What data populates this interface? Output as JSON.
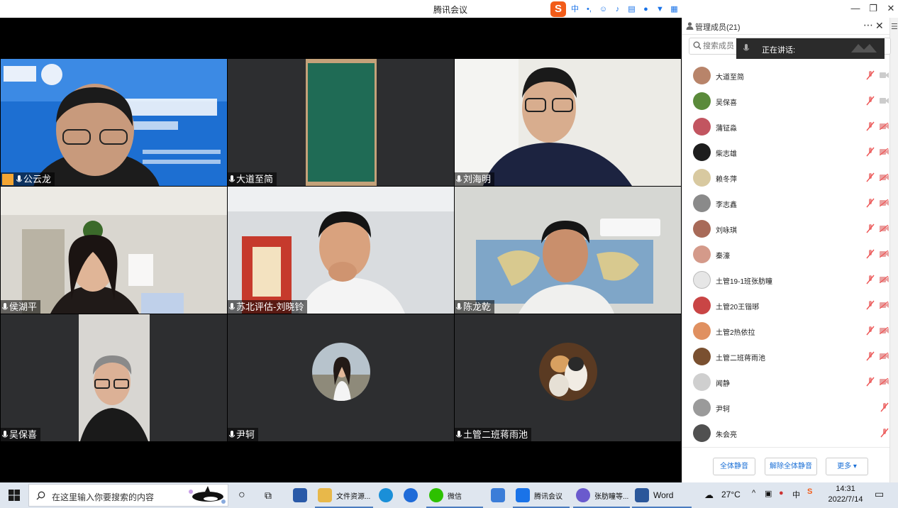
{
  "window": {
    "title": "腾讯会议"
  },
  "video_tiles": [
    {
      "name": "公云龙",
      "host": true
    },
    {
      "name": "大道至简"
    },
    {
      "name": "刘海明"
    },
    {
      "name": "侯湖平"
    },
    {
      "name": "苏北评估-刘晓铃"
    },
    {
      "name": "陈龙乾"
    },
    {
      "name": "吴保喜"
    },
    {
      "name": "尹轲"
    },
    {
      "name": "土管二班蒋雨池"
    }
  ],
  "members_panel": {
    "title": "管理成员(21)",
    "search_placeholder": "搜索成员",
    "speaking_label": "正在讲话:",
    "members": [
      {
        "name": "大道至简",
        "avatar_color": "#b8846a"
      },
      {
        "name": "吴保喜",
        "avatar_color": "#5a8a3a"
      },
      {
        "name": "蒲钲淼",
        "avatar_color": "#c25560"
      },
      {
        "name": "柴志雄",
        "avatar_color": "#1d1d1d"
      },
      {
        "name": "赖冬萍",
        "avatar_color": "#d8c9a0"
      },
      {
        "name": "李志鑫",
        "avatar_color": "#8a8a8a"
      },
      {
        "name": "刘咏琪",
        "avatar_color": "#a86a58"
      },
      {
        "name": "秦濠",
        "avatar_color": "#d49a8a"
      },
      {
        "name": "土管19-1班张肪瞳",
        "avatar_color": "#e6e6e6"
      },
      {
        "name": "土管20王锴琊",
        "avatar_color": "#c94545"
      },
      {
        "name": "土管2热依拉",
        "avatar_color": "#e09060"
      },
      {
        "name": "土管二班蒋雨池",
        "avatar_color": "#7a5030"
      },
      {
        "name": "闻静",
        "avatar_color": "#cfcfcf"
      },
      {
        "name": "尹轲",
        "avatar_color": "#9a9a9a"
      },
      {
        "name": "朱会亮",
        "avatar_color": "#505050"
      }
    ],
    "buttons": {
      "mute_all": "全体静音",
      "unmute_all": "解除全体静音",
      "more": "更多 ▾"
    }
  },
  "taskbar": {
    "search_placeholder": "在这里输入你要搜索的内容",
    "apps": [
      {
        "label": "文件资源...",
        "color": "#e8b84a"
      },
      {
        "label": "微信",
        "color": "#2dc100"
      },
      {
        "label": "腾讯会议",
        "color": "#1a73e8"
      },
      {
        "label": "张肪瞳等...",
        "color": "#6a5acd"
      },
      {
        "label": "Word",
        "color": "#2b579a"
      }
    ],
    "weather": "27°C",
    "ime_lang": "中",
    "time": "14:31",
    "date": "2022/7/14"
  }
}
